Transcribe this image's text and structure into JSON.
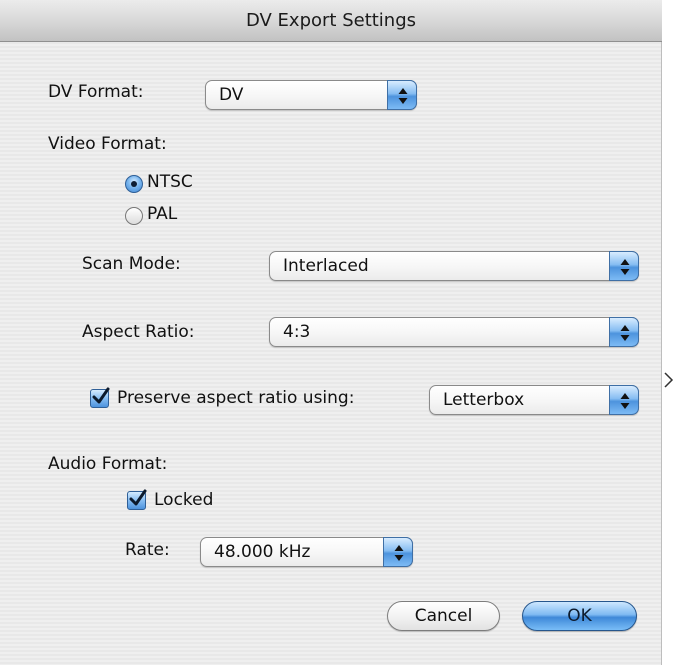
{
  "window": {
    "title": "DV Export Settings"
  },
  "dv_format": {
    "label": "DV Format:",
    "value": "DV"
  },
  "video_format": {
    "label": "Video Format:",
    "options": [
      {
        "label": "NTSC",
        "selected": true
      },
      {
        "label": "PAL",
        "selected": false
      }
    ],
    "scan_mode": {
      "label": "Scan Mode:",
      "value": "Interlaced"
    },
    "aspect_ratio": {
      "label": "Aspect Ratio:",
      "value": "4:3"
    },
    "preserve": {
      "label": "Preserve aspect ratio using:",
      "checked": true,
      "value": "Letterbox"
    }
  },
  "audio_format": {
    "label": "Audio Format:",
    "locked": {
      "label": "Locked",
      "checked": true
    },
    "rate": {
      "label": "Rate:",
      "value": "48.000 kHz"
    }
  },
  "buttons": {
    "cancel": "Cancel",
    "ok": "OK"
  },
  "colors": {
    "accent_blue": "#4d93dd",
    "window_bg": "#ececec",
    "title_text": "#1b1b1b"
  },
  "icons": {
    "popup_arrows": "up-down-arrows-icon",
    "checkmark": "checkmark-icon",
    "radio_dot": "radio-dot-icon"
  }
}
